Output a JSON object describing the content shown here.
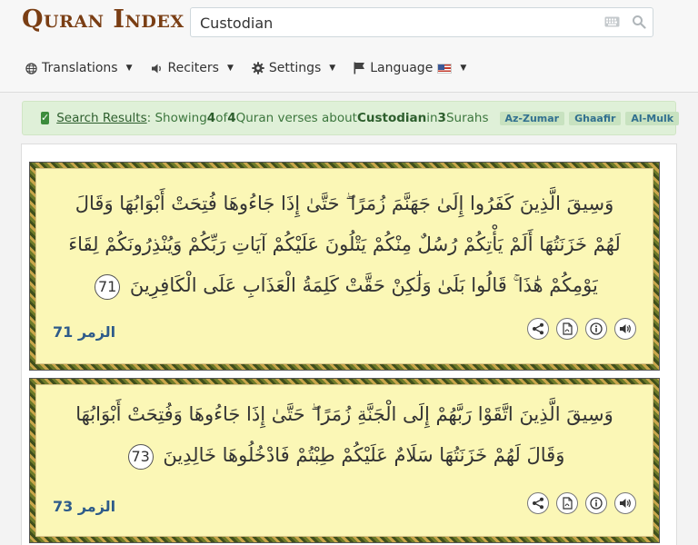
{
  "header": {
    "logo_text": "Quran Index",
    "search": {
      "value": "Custodian",
      "placeholder": ""
    },
    "nav": {
      "translations": "Translations",
      "reciters": "Reciters",
      "settings": "Settings",
      "language": "Language"
    }
  },
  "banner": {
    "link_text": "Search Results",
    "text_1": ": Showing ",
    "shown": "4",
    "text_2": " of ",
    "total": "4",
    "text_3": " Quran verses about ",
    "term": "Custodian",
    "text_4": " in ",
    "surah_count": "3",
    "text_5": " Surahs",
    "surahs": [
      "Az-Zumar",
      "Ghaafir",
      "Al-Mulk"
    ]
  },
  "verses": [
    {
      "text": "وَسِيقَ الَّذِينَ كَفَرُوا إِلَىٰ جَهَنَّمَ زُمَرًا ۖ حَتَّىٰ إِذَا جَاءُوهَا فُتِحَتْ أَبْوَابُهَا وَقَالَ لَهُمْ خَزَنَتُهَا أَلَمْ يَأْتِكُمْ رُسُلٌ مِنْكُمْ يَتْلُونَ عَلَيْكُمْ آيَاتِ رَبِّكُمْ وَيُنْذِرُونَكُمْ لِقَاءَ يَوْمِكُمْ هَٰذَا ۚ قَالُوا بَلَىٰ وَلَٰكِنْ حَقَّتْ كَلِمَةُ الْعَذَابِ عَلَى الْكَافِرِينَ",
      "number": "71",
      "reference": "الزمر 71"
    },
    {
      "text": "وَسِيقَ الَّذِينَ اتَّقَوْا رَبَّهُمْ إِلَى الْجَنَّةِ زُمَرًا ۖ حَتَّىٰ إِذَا جَاءُوهَا وَفُتِحَتْ أَبْوَابُهَا وَقَالَ لَهُمْ خَزَنَتُهَا سَلَامٌ عَلَيْكُمْ طِبْتُمْ فَادْخُلُوهَا خَالِدِينَ",
      "number": "73",
      "reference": "الزمر 73"
    }
  ],
  "icons": [
    "globe-icon",
    "speaker-icon",
    "gear-icon",
    "flag-icon",
    "keyboard-icon",
    "search-icon",
    "share-icon",
    "pdf-icon",
    "info-icon",
    "audio-icon"
  ],
  "colors": {
    "accent": "#7a3e14",
    "banner_bg": "#dff0d8",
    "verse_bg": "#fbf7b6",
    "reference": "#2e5b8a"
  }
}
